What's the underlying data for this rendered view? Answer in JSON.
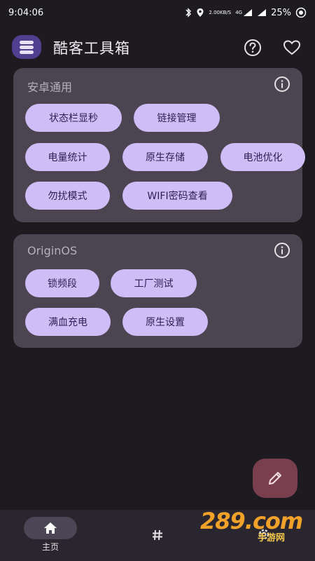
{
  "status_bar": {
    "time": "9:04:06",
    "net_speed_value": "2.00",
    "net_speed_unit": "KB/S",
    "network_type": "4G",
    "battery": "25%"
  },
  "app": {
    "title": "酷客工具箱"
  },
  "cards": [
    {
      "title": "安卓通用",
      "chips": [
        "状态栏显秒",
        "链接管理",
        "电量统计",
        "原生存储",
        "电池优化",
        "勿扰模式",
        "WIFI密码查看"
      ]
    },
    {
      "title": "OriginOS",
      "chips": [
        "锁频段",
        "工厂测试",
        "满血充电",
        "原生设置"
      ]
    }
  ],
  "bottom_nav": {
    "home_label": "主页"
  },
  "watermark": {
    "brand": "289.com",
    "sub": "手游网"
  },
  "colors": {
    "background": "#1d1b20",
    "card": "#4a4550",
    "chip": "#cfbdf7",
    "chip_text": "#2c1f52",
    "fab": "#7a3f4e"
  }
}
